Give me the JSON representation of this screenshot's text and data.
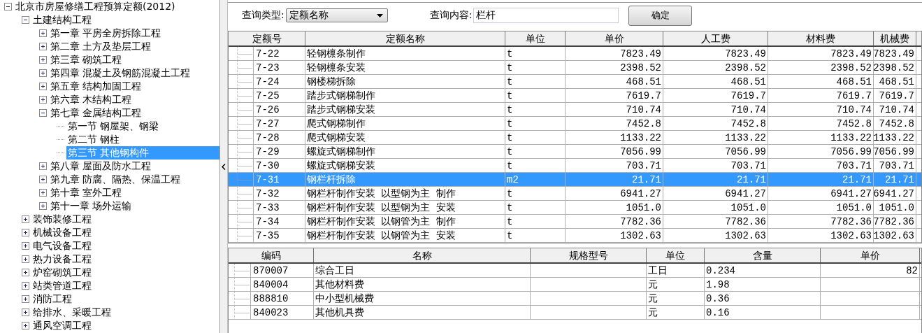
{
  "tree": [
    {
      "label": "北京市房屋修缮工程预算定额(2012)",
      "expanded": true,
      "selected": false,
      "children": [
        {
          "label": "土建结构工程",
          "expanded": true,
          "selected": false,
          "children": [
            {
              "label": "第一章  平房全房拆除工程",
              "expanded": false,
              "selected": false
            },
            {
              "label": "第二章  土方及垫层工程",
              "expanded": false,
              "selected": false
            },
            {
              "label": "第三章  砌筑工程",
              "expanded": false,
              "selected": false
            },
            {
              "label": "第四章  混凝土及钢筋混凝土工程",
              "expanded": false,
              "selected": false
            },
            {
              "label": "第五章  结构加固工程",
              "expanded": false,
              "selected": false
            },
            {
              "label": "第六章  木结构工程",
              "expanded": false,
              "selected": false
            },
            {
              "label": "第七章  金属结构工程",
              "expanded": true,
              "selected": false,
              "children": [
                {
                  "label": "第一节  钢屋架、钢梁",
                  "selected": false
                },
                {
                  "label": "第二节  钢柱",
                  "selected": false
                },
                {
                  "label": "第三节  其他钢构件",
                  "selected": true
                }
              ]
            },
            {
              "label": "第八章  屋面及防水工程",
              "expanded": false,
              "selected": false
            },
            {
              "label": "第九章  防腐、隔热、保温工程",
              "expanded": false,
              "selected": false
            },
            {
              "label": "第十章  室外工程",
              "expanded": false,
              "selected": false
            },
            {
              "label": "第十一章  场外运输",
              "expanded": false,
              "selected": false
            }
          ]
        },
        {
          "label": "装饰装修工程",
          "expanded": false,
          "selected": false
        },
        {
          "label": "机械设备工程",
          "expanded": false,
          "selected": false
        },
        {
          "label": "电气设备工程",
          "expanded": false,
          "selected": false
        },
        {
          "label": "热力设备工程",
          "expanded": false,
          "selected": false
        },
        {
          "label": "炉窑砌筑工程",
          "expanded": false,
          "selected": false
        },
        {
          "label": "站类管道工程",
          "expanded": false,
          "selected": false
        },
        {
          "label": "消防工程",
          "expanded": false,
          "selected": false
        },
        {
          "label": "给排水、采暖工程",
          "expanded": false,
          "selected": false
        },
        {
          "label": "通风空调工程",
          "expanded": false,
          "selected": false
        }
      ]
    }
  ],
  "query": {
    "type_label": "查询类型:",
    "type_value": "定额名称",
    "content_label": "查询内容:",
    "content_value": "栏杆",
    "confirm": "确定"
  },
  "quota_table": {
    "columns": [
      "定额号",
      "定额名称",
      "单位",
      "单价",
      "人工费",
      "材料费",
      "机械费"
    ],
    "rows": [
      {
        "cells": [
          "7-22",
          "轻钢檩条制作",
          "t",
          "7823.49",
          "7823.49",
          "7823.49",
          "7823.49"
        ],
        "selected": false
      },
      {
        "cells": [
          "7-23",
          "轻钢檩条安装",
          "t",
          "2398.52",
          "2398.52",
          "2398.52",
          "2398.52"
        ],
        "selected": false
      },
      {
        "cells": [
          "7-24",
          "钢楼梯拆除",
          "t",
          "468.51",
          "468.51",
          "468.51",
          "468.51"
        ],
        "selected": false
      },
      {
        "cells": [
          "7-25",
          "踏步式钢梯制作",
          "t",
          "7619.7",
          "7619.7",
          "7619.7",
          "7619.7"
        ],
        "selected": false
      },
      {
        "cells": [
          "7-26",
          "踏步式钢梯安装",
          "t",
          "710.74",
          "710.74",
          "710.74",
          "710.74"
        ],
        "selected": false
      },
      {
        "cells": [
          "7-27",
          "爬式钢梯制作",
          "t",
          "7452.8",
          "7452.8",
          "7452.8",
          "7452.8"
        ],
        "selected": false
      },
      {
        "cells": [
          "7-28",
          "爬式钢梯安装",
          "t",
          "1133.22",
          "1133.22",
          "1133.22",
          "1133.22"
        ],
        "selected": false
      },
      {
        "cells": [
          "7-29",
          "螺旋式钢梯制作",
          "t",
          "7056.99",
          "7056.99",
          "7056.99",
          "7056.99"
        ],
        "selected": false
      },
      {
        "cells": [
          "7-30",
          "螺旋式钢梯安装",
          "t",
          "703.71",
          "703.71",
          "703.71",
          "703.71"
        ],
        "selected": false
      },
      {
        "cells": [
          "7-31",
          "钢栏杆拆除",
          "m2",
          "21.71",
          "21.71",
          "21.71",
          "21.71"
        ],
        "selected": true
      },
      {
        "cells": [
          "7-32",
          "钢栏杆制作安装  以型钢为主  制作",
          "t",
          "6941.27",
          "6941.27",
          "6941.27",
          "6941.27"
        ],
        "selected": false
      },
      {
        "cells": [
          "7-33",
          "钢栏杆制作安装  以型钢为主  安装",
          "t",
          "1051.0",
          "1051.0",
          "1051.0",
          "1051.0"
        ],
        "selected": false
      },
      {
        "cells": [
          "7-34",
          "钢栏杆制作安装  以钢管为主  制作",
          "t",
          "7782.36",
          "7782.36",
          "7782.36",
          "7782.36"
        ],
        "selected": false
      },
      {
        "cells": [
          "7-35",
          "钢栏杆制作安装  以钢管为主  安装",
          "t",
          "1302.63",
          "1302.63",
          "1302.63",
          "1302.63"
        ],
        "selected": false
      }
    ]
  },
  "resource_table": {
    "columns": [
      "编码",
      "名称",
      "规格型号",
      "单位",
      "含量",
      "单价"
    ],
    "rows": [
      {
        "cells": [
          "870007",
          "综合工日",
          "",
          "工日",
          "0.234",
          "82"
        ]
      },
      {
        "cells": [
          "840004",
          "其他材料费",
          "",
          "元",
          "1.98",
          ""
        ]
      },
      {
        "cells": [
          "888810",
          "中小型机械费",
          "",
          "元",
          "0.36",
          ""
        ]
      },
      {
        "cells": [
          "840023",
          "其他机具费",
          "",
          "元",
          "0.16",
          ""
        ]
      }
    ]
  }
}
